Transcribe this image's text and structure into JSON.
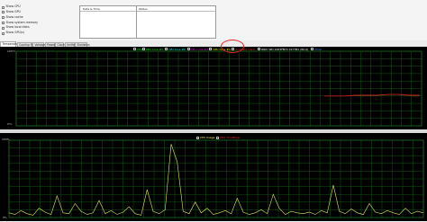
{
  "checkboxes": [
    {
      "label": "Show CPU",
      "checked": false
    },
    {
      "label": "Show GPU",
      "checked": false
    },
    {
      "label": "Show cache",
      "checked": false
    },
    {
      "label": "Show system memory",
      "checked": false
    },
    {
      "label": "Show local disks",
      "checked": false
    },
    {
      "label": "Show GPU(s)",
      "checked": false
    }
  ],
  "table": {
    "col_date_time": "Date & Time",
    "col_status": "Status"
  },
  "tabs": [
    {
      "label": "Temperatures",
      "active": true
    },
    {
      "label": "Cooling Fans",
      "active": false
    },
    {
      "label": "Voltages",
      "active": false
    },
    {
      "label": "Powers",
      "active": false
    },
    {
      "label": "Clocks",
      "active": false
    },
    {
      "label": "Unified",
      "active": false
    },
    {
      "label": "Statistics",
      "active": false
    }
  ],
  "temp_chart": {
    "legend": [
      {
        "label": "CPU",
        "color": "#00ff00"
      },
      {
        "label": "CPU Core #1",
        "color": "#00ff00"
      },
      {
        "label": "CPU Core #2",
        "color": "#00ffff"
      },
      {
        "label": "CPU Core #3",
        "color": "#ff00ff"
      },
      {
        "label": "CPU Core #4",
        "color": "#ffff00"
      },
      {
        "label": "Graphics Card",
        "color": "#ff3030"
      },
      {
        "label": "WDC WD 1003FBYX 01Y7B1 (80.0)",
        "color": "#ffffff"
      },
      {
        "label": "Other",
        "color": "#4080ff"
      }
    ],
    "y_top": "100°C",
    "y_bottom": "0°C",
    "line_color": "#cc2222",
    "grid_color": "#0f5a0f"
  },
  "cpu_chart": {
    "legend": [
      {
        "label": "CPU Usage",
        "color": "#ffff80"
      },
      {
        "label": "CPU Throttling",
        "color": "#ff3030"
      }
    ],
    "y_top": "100%",
    "y_bottom": "0%",
    "line_color": "#e6e66a",
    "grid_color": "#0f5a0f"
  },
  "chart_data": [
    {
      "type": "line",
      "title": "",
      "series": [
        {
          "name": "Graphics Card",
          "values": [
            40,
            40,
            40,
            41,
            41,
            41,
            42,
            42,
            41,
            41
          ]
        }
      ],
      "x": [
        0,
        1,
        2,
        3,
        4,
        5,
        6,
        7,
        8,
        9
      ],
      "ylim": [
        0,
        100
      ],
      "grid": true
    },
    {
      "type": "line",
      "title": "",
      "series": [
        {
          "name": "CPU Usage",
          "values": [
            6,
            4,
            9,
            5,
            3,
            12,
            7,
            4,
            28,
            6,
            5,
            18,
            8,
            4,
            6,
            22,
            5,
            9,
            4,
            7,
            14,
            5,
            3,
            36,
            8,
            5,
            10,
            95,
            72,
            8,
            5,
            20,
            6,
            12,
            4,
            6,
            9,
            5,
            25,
            7,
            4,
            6,
            10,
            5,
            30,
            12,
            4,
            8,
            6,
            5,
            7,
            4,
            9,
            6,
            42,
            8,
            5,
            11,
            6,
            4,
            18,
            7,
            5,
            9,
            6,
            4,
            12,
            5,
            8,
            6
          ]
        }
      ],
      "ylim": [
        0,
        100
      ],
      "grid": true
    }
  ]
}
